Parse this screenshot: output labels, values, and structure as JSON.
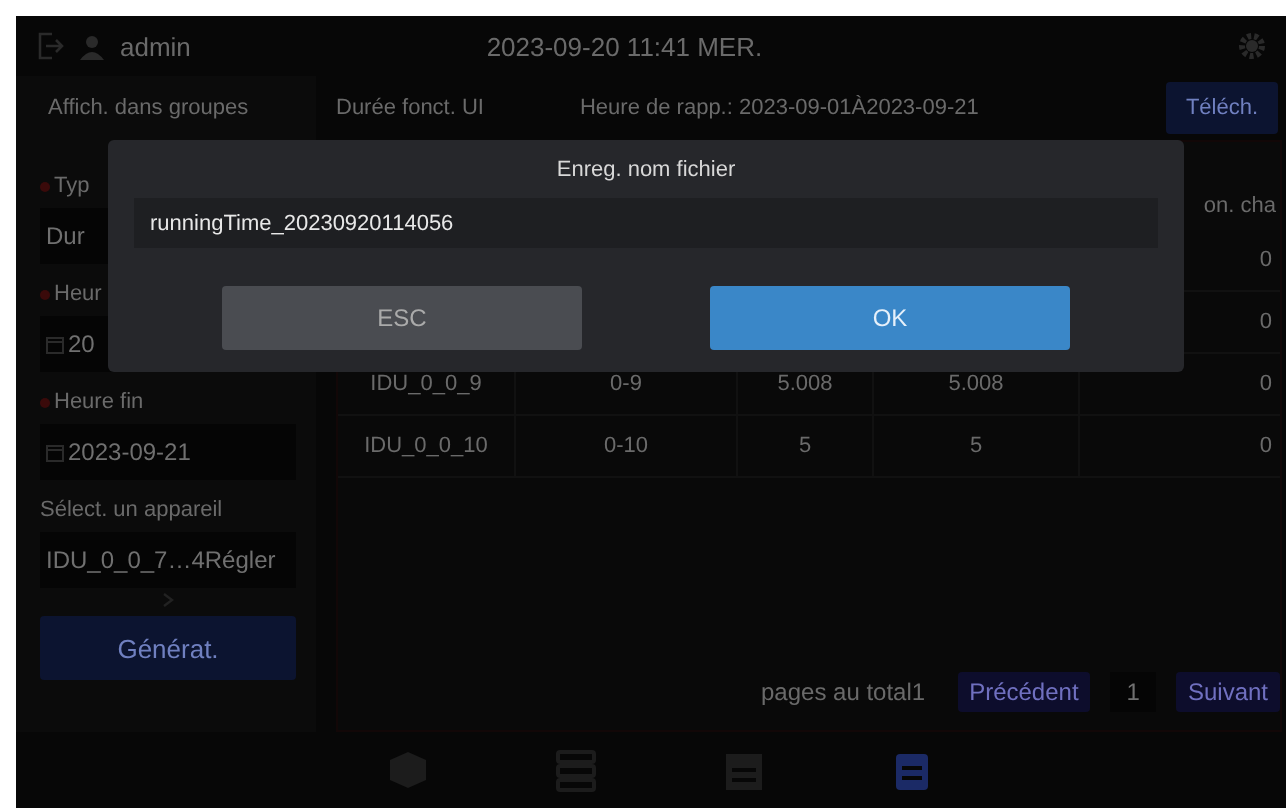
{
  "header": {
    "user": "admin",
    "datetime": "2023-09-20 11:41 MER."
  },
  "subbar": {
    "group_tab": "Affich. dans groupes",
    "report_title": "Durée fonct. UI",
    "report_period": "Heure de rapp.: 2023-09-01À2023-09-21",
    "download_button": "Téléch."
  },
  "form": {
    "fields": [
      {
        "kind": "select",
        "label": "Typ",
        "required": true,
        "value": "Dur"
      },
      {
        "kind": "date",
        "label": "Heur",
        "required": true,
        "value": "20"
      },
      {
        "kind": "date",
        "label": "Heure fin",
        "required": true,
        "value": "2023-09-21"
      },
      {
        "kind": "device",
        "label": "Sélect. un appareil",
        "required": false,
        "value": "IDU_0_0_7…4Régler"
      }
    ],
    "generate_button": "Générat."
  },
  "table": {
    "header": {
      "column_5": "on. cha"
    },
    "rows": [
      {
        "column_5": "0"
      },
      {
        "column_5": "0"
      },
      {
        "column_1": "IDU_0_0_9",
        "column_2": "0-9",
        "column_3": "5.008",
        "column_4": "5.008",
        "column_5": "0"
      },
      {
        "column_1": "IDU_0_0_10",
        "column_2": "0-10",
        "column_3": "5",
        "column_4": "5",
        "column_5": "0"
      }
    ]
  },
  "pagination": {
    "total": "pages au total1",
    "previous": "Précédent",
    "page": "1",
    "next": "Suivant"
  },
  "bottom_nav": [
    {
      "kind": "cube",
      "selected": false
    },
    {
      "kind": "server",
      "selected": false
    },
    {
      "kind": "calendar",
      "selected": false
    },
    {
      "kind": "clipboard",
      "selected": true
    }
  ],
  "dialog": {
    "title": "Enreg. nom fichier",
    "value": "runningTime_20230920114056",
    "cancel": "ESC",
    "confirm": "OK"
  }
}
